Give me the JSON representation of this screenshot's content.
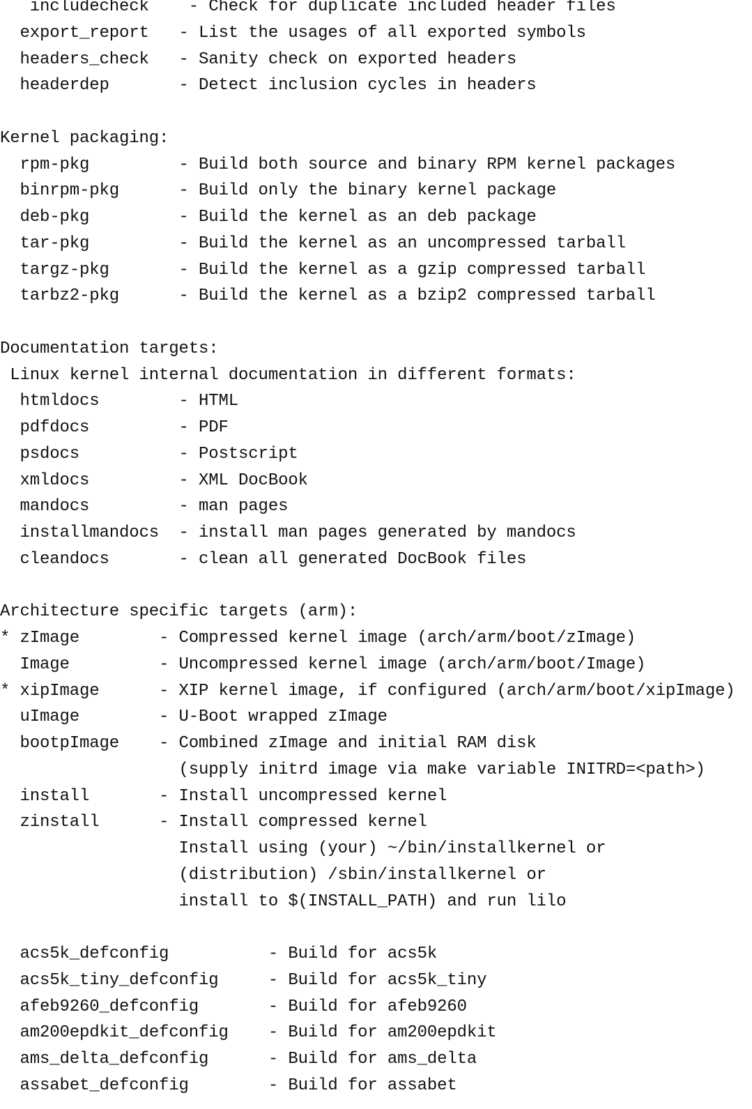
{
  "terminal": {
    "lines": [
      "   includecheck    - Check for duplicate included header files",
      "  export_report   - List the usages of all exported symbols",
      "  headers_check   - Sanity check on exported headers",
      "  headerdep       - Detect inclusion cycles in headers",
      "",
      "Kernel packaging:",
      "  rpm-pkg         - Build both source and binary RPM kernel packages",
      "  binrpm-pkg      - Build only the binary kernel package",
      "  deb-pkg         - Build the kernel as an deb package",
      "  tar-pkg         - Build the kernel as an uncompressed tarball",
      "  targz-pkg       - Build the kernel as a gzip compressed tarball",
      "  tarbz2-pkg      - Build the kernel as a bzip2 compressed tarball",
      "",
      "Documentation targets:",
      " Linux kernel internal documentation in different formats:",
      "  htmldocs        - HTML",
      "  pdfdocs         - PDF",
      "  psdocs          - Postscript",
      "  xmldocs         - XML DocBook",
      "  mandocs         - man pages",
      "  installmandocs  - install man pages generated by mandocs",
      "  cleandocs       - clean all generated DocBook files",
      "",
      "Architecture specific targets (arm):",
      "* zImage        - Compressed kernel image (arch/arm/boot/zImage)",
      "  Image         - Uncompressed kernel image (arch/arm/boot/Image)",
      "* xipImage      - XIP kernel image, if configured (arch/arm/boot/xipImage)",
      "  uImage        - U-Boot wrapped zImage",
      "  bootpImage    - Combined zImage and initial RAM disk",
      "                  (supply initrd image via make variable INITRD=<path>)",
      "  install       - Install uncompressed kernel",
      "  zinstall      - Install compressed kernel",
      "                  Install using (your) ~/bin/installkernel or",
      "                  (distribution) /sbin/installkernel or",
      "                  install to $(INSTALL_PATH) and run lilo",
      "",
      "  acs5k_defconfig          - Build for acs5k",
      "  acs5k_tiny_defconfig     - Build for acs5k_tiny",
      "  afeb9260_defconfig       - Build for afeb9260",
      "  am200epdkit_defconfig    - Build for am200epdkit",
      "  ams_delta_defconfig      - Build for ams_delta",
      "  assabet_defconfig        - Build for assabet"
    ]
  }
}
